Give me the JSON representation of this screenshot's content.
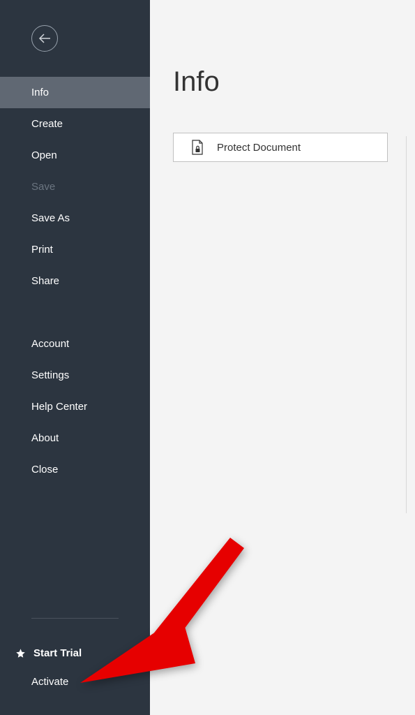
{
  "sidebar": {
    "nav_primary": [
      {
        "label": "Info",
        "active": true,
        "disabled": false
      },
      {
        "label": "Create",
        "active": false,
        "disabled": false
      },
      {
        "label": "Open",
        "active": false,
        "disabled": false
      },
      {
        "label": "Save",
        "active": false,
        "disabled": true
      },
      {
        "label": "Save As",
        "active": false,
        "disabled": false
      },
      {
        "label": "Print",
        "active": false,
        "disabled": false
      },
      {
        "label": "Share",
        "active": false,
        "disabled": false
      }
    ],
    "nav_secondary": [
      {
        "label": "Account"
      },
      {
        "label": "Settings"
      },
      {
        "label": "Help Center"
      },
      {
        "label": "About"
      },
      {
        "label": "Close"
      }
    ],
    "trial_label": "Start Trial",
    "activate_label": "Activate"
  },
  "main": {
    "title": "Info",
    "protect_label": "Protect Document"
  },
  "icons": {
    "back": "back-arrow-icon",
    "star": "star-icon",
    "doc_lock": "document-lock-icon"
  }
}
